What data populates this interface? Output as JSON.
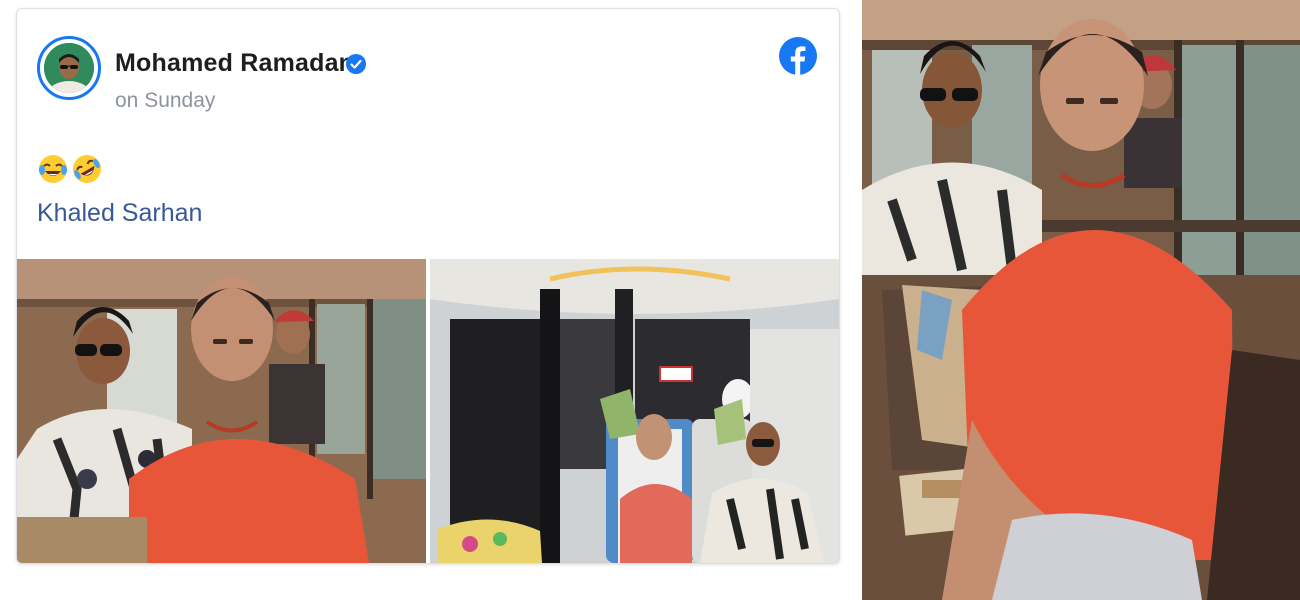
{
  "post": {
    "author": "Mohamed Ramadan",
    "verified": true,
    "time": "on Sunday",
    "emojis": [
      "face-with-tears-of-joy",
      "rolling-on-the-floor-laughing"
    ],
    "tagged": "Khaled Sarhan",
    "platform_icon": "facebook-icon"
  },
  "photos": [
    {
      "id": "bus-photo",
      "description_icon": "photo"
    },
    {
      "id": "jet-photo",
      "description_icon": "photo"
    },
    {
      "id": "side-bus-photo",
      "description_icon": "photo"
    }
  ],
  "colors": {
    "facebook_blue": "#1877f2",
    "name_text": "#1c1e21",
    "muted_text": "#8d949e",
    "link_text": "#385898",
    "shirt_orange": "#e8563a"
  }
}
